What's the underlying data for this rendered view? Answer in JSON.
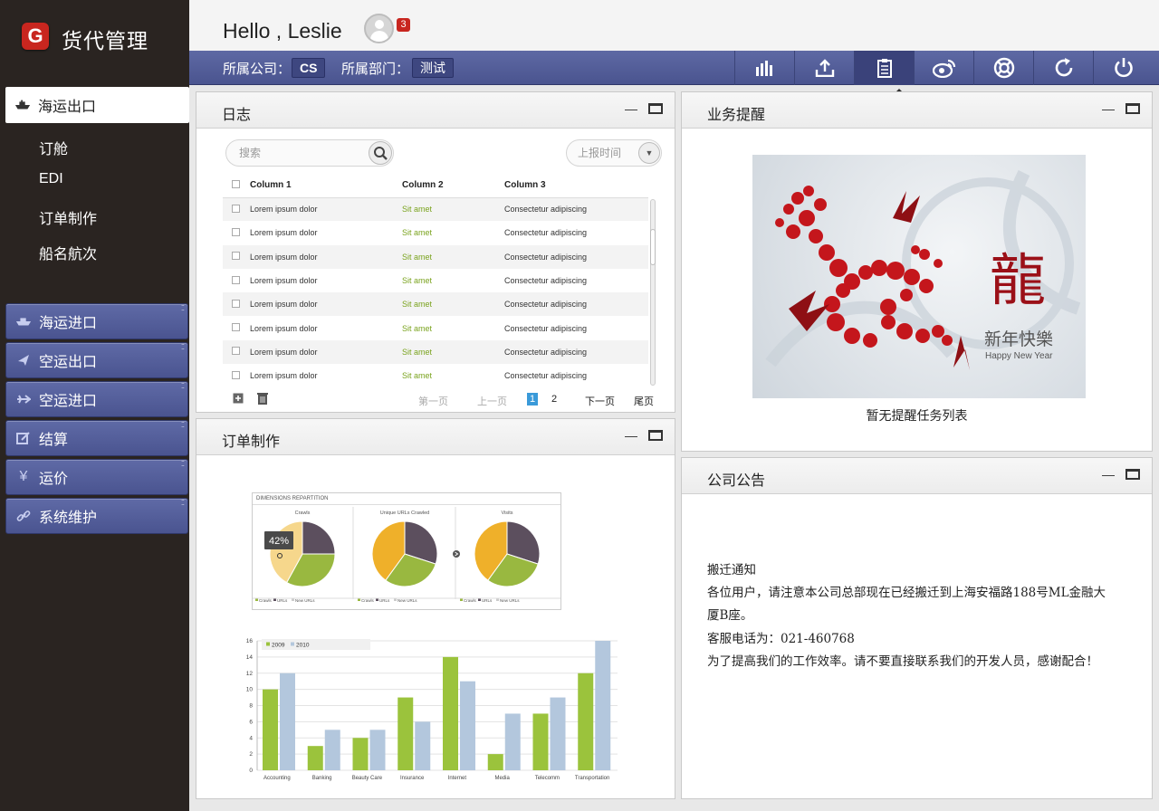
{
  "app": {
    "logo_letter": "G",
    "title": "货代管理"
  },
  "header": {
    "greeting": "Hello , Leslie",
    "notification_count": "3"
  },
  "toolbar": {
    "company_label": "所属公司：",
    "company_value": "CS",
    "dept_label": "所属部门：",
    "dept_value": "测试",
    "icons": [
      "stats-icon",
      "upload-icon",
      "log-icon",
      "weibo-icon",
      "help-icon",
      "refresh-icon",
      "power-icon"
    ],
    "tooltip": "日志"
  },
  "sidebar": {
    "active": {
      "label": "海运出口",
      "icon": "ship-icon"
    },
    "subitems": [
      "订舱",
      "EDI",
      "订单制作",
      "船名航次"
    ],
    "groups": [
      {
        "label": "海运进口",
        "icon": "ship-icon"
      },
      {
        "label": "空运出口",
        "icon": "plane-icon"
      },
      {
        "label": "空运进口",
        "icon": "plane-icon"
      },
      {
        "label": "结算",
        "icon": "edit-icon"
      },
      {
        "label": "运价",
        "icon": "yen-icon"
      },
      {
        "label": "系统维护",
        "icon": "link-icon"
      }
    ]
  },
  "log_panel": {
    "title": "日志",
    "search_placeholder": "搜索",
    "sort_label": "上报时间",
    "columns": [
      "Column 1",
      "Column 2",
      "Column 3"
    ],
    "rows": [
      [
        "Lorem ipsum dolor",
        "Sit amet",
        "Consectetur adipiscing"
      ],
      [
        "Lorem ipsum dolor",
        "Sit amet",
        "Consectetur adipiscing"
      ],
      [
        "Lorem ipsum dolor",
        "Sit amet",
        "Consectetur adipiscing"
      ],
      [
        "Lorem ipsum dolor",
        "Sit amet",
        "Consectetur adipiscing"
      ],
      [
        "Lorem ipsum dolor",
        "Sit amet",
        "Consectetur adipiscing"
      ],
      [
        "Lorem ipsum dolor",
        "Sit amet",
        "Consectetur adipiscing"
      ],
      [
        "Lorem ipsum dolor",
        "Sit amet",
        "Consectetur adipiscing"
      ],
      [
        "Lorem ipsum dolor",
        "Sit amet",
        "Consectetur adipiscing"
      ]
    ],
    "pager": {
      "first": "第一页",
      "prev": "上一页",
      "page1": "1",
      "page2": "2",
      "next": "下一页",
      "last": "尾页"
    }
  },
  "reminder_panel": {
    "title": "业务提醒",
    "image_char": "龍",
    "image_text_cn": "新年快樂",
    "image_text_en": "Happy New Year",
    "empty_text": "暂无提醒任务列表"
  },
  "order_panel": {
    "title": "订单制作"
  },
  "notice_panel": {
    "title": "公司公告",
    "lines": [
      "搬迁通知",
      "各位用户，请注意本公司总部现在已经搬迁到上海安福路188号ML金融大",
      "厦B座。",
      "客服电话为：021-460768",
      "为了提高我们的工作效率。请不要直接联系我们的开发人员，感谢配合！"
    ]
  },
  "chart_data": [
    {
      "type": "pie",
      "title": "DIMENSIONS REPARTITION",
      "charts": [
        {
          "name": "Crawls",
          "slices": [
            {
              "label": "Crawls",
              "value": 42
            },
            {
              "label": "URLs",
              "value": 33
            },
            {
              "label": "New URLs",
              "value": 25
            }
          ],
          "tooltip": "42%"
        },
        {
          "name": "Unique URLs Crawled",
          "slices": [
            {
              "label": "Crawls",
              "value": 40
            },
            {
              "label": "URLs",
              "value": 30
            },
            {
              "label": "New URLs",
              "value": 30
            }
          ]
        },
        {
          "name": "Visits",
          "slices": [
            {
              "label": "Crawls",
              "value": 40
            },
            {
              "label": "URLs",
              "value": 30
            },
            {
              "label": "New URLs",
              "value": 30
            }
          ]
        }
      ],
      "legend": [
        "Crawls",
        "URLs",
        "New URLs"
      ],
      "colors": [
        "#efb02a",
        "#99b840",
        "#5c4f5e",
        "#f6d78c"
      ]
    },
    {
      "type": "bar",
      "categories": [
        "Accounting",
        "Banking",
        "Beauty Care",
        "Insurance",
        "Internet",
        "Media",
        "Telecomm",
        "Transportation"
      ],
      "series": [
        {
          "name": "2009",
          "values": [
            10,
            3,
            4,
            9,
            14,
            2,
            7,
            12
          ],
          "color": "#9bc33c"
        },
        {
          "name": "2010",
          "values": [
            12,
            5,
            5,
            6,
            11,
            7,
            9,
            16
          ],
          "color": "#b3c7dd"
        }
      ],
      "ylim": [
        0,
        16
      ],
      "yticks": [
        0,
        2,
        4,
        6,
        8,
        10,
        12,
        14,
        16
      ],
      "legend_position": "top-left",
      "grid": true
    }
  ]
}
